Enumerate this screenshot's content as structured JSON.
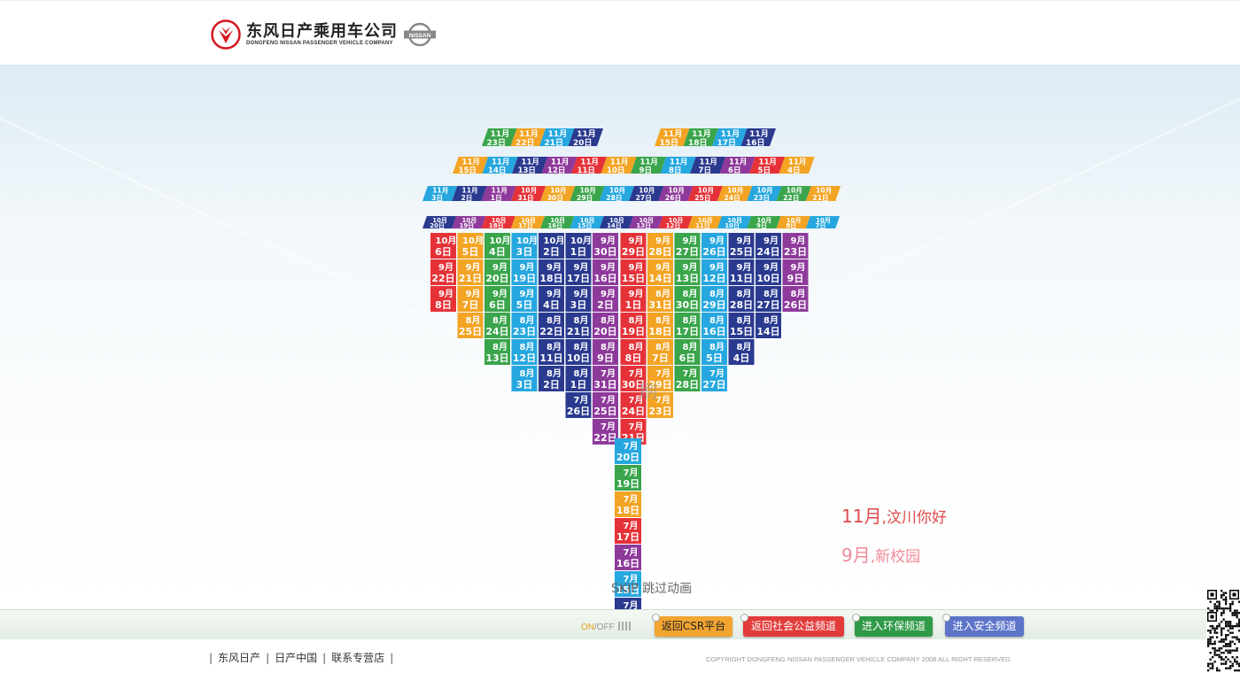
{
  "brand": {
    "name_cn": "东风日产乘用车公司",
    "name_en": "DONGFENG NISSAN PASSENGER VEHICLE COMPANY",
    "partner_logo": "NISSAN"
  },
  "colors": {
    "red": "#e53238",
    "orange": "#f3a424",
    "green": "#3aa54b",
    "blue": "#26a7df",
    "purple": "#8e3a9b",
    "navy": "#2a3a8f",
    "teal": "#1ea59b"
  },
  "grid_columns": [
    {
      "color": "red",
      "cells": [
        [
          "10月",
          "6日"
        ],
        [
          "9月",
          "22日"
        ],
        [
          "9月",
          "8日"
        ]
      ]
    },
    {
      "color": "orange",
      "cells": [
        [
          "10月",
          "5日"
        ],
        [
          "9月",
          "21日"
        ],
        [
          "9月",
          "7日"
        ],
        [
          "8月",
          "25日"
        ]
      ]
    },
    {
      "color": "green",
      "cells": [
        [
          "10月",
          "4日"
        ],
        [
          "9月",
          "20日"
        ],
        [
          "9月",
          "6日"
        ],
        [
          "8月",
          "24日"
        ],
        [
          "8月",
          "13日"
        ]
      ]
    },
    {
      "color": "blue",
      "cells": [
        [
          "10月",
          "3日"
        ],
        [
          "9月",
          "19日"
        ],
        [
          "9月",
          "5日"
        ],
        [
          "8月",
          "23日"
        ],
        [
          "8月",
          "12日"
        ],
        [
          "8月",
          "3日"
        ]
      ]
    },
    {
      "color": "navy",
      "cells": [
        [
          "10月",
          "2日"
        ],
        [
          "9月",
          "18日"
        ],
        [
          "9月",
          "4日"
        ],
        [
          "8月",
          "22日"
        ],
        [
          "8月",
          "11日"
        ],
        [
          "8月",
          "2日"
        ]
      ]
    },
    {
      "color": "navy",
      "cells": [
        [
          "10月",
          "1日"
        ],
        [
          "9月",
          "17日"
        ],
        [
          "9月",
          "3日"
        ],
        [
          "8月",
          "21日"
        ],
        [
          "8月",
          "10日"
        ],
        [
          "8月",
          "1日"
        ],
        [
          "7月",
          "26日"
        ]
      ]
    },
    {
      "color": "purple",
      "cells": [
        [
          "9月",
          "30日"
        ],
        [
          "9月",
          "16日"
        ],
        [
          "9月",
          "2日"
        ],
        [
          "8月",
          "20日"
        ],
        [
          "8月",
          "9日"
        ],
        [
          "7月",
          "31日"
        ],
        [
          "7月",
          "25日"
        ],
        [
          "7月",
          "22日"
        ]
      ]
    },
    {
      "color": "red",
      "cells": [
        [
          "9月",
          "29日"
        ],
        [
          "9月",
          "15日"
        ],
        [
          "9月",
          "1日"
        ],
        [
          "8月",
          "19日"
        ],
        [
          "8月",
          "8日"
        ],
        [
          "7月",
          "30日"
        ],
        [
          "7月",
          "24日"
        ],
        [
          "7月",
          "21日"
        ]
      ]
    },
    {
      "color": "orange",
      "cells": [
        [
          "9月",
          "28日"
        ],
        [
          "9月",
          "14日"
        ],
        [
          "8月",
          "31日"
        ],
        [
          "8月",
          "18日"
        ],
        [
          "8月",
          "7日"
        ],
        [
          "7月",
          "29日"
        ],
        [
          "7月",
          "23日"
        ]
      ]
    },
    {
      "color": "green",
      "cells": [
        [
          "9月",
          "27日"
        ],
        [
          "9月",
          "13日"
        ],
        [
          "8月",
          "30日"
        ],
        [
          "8月",
          "17日"
        ],
        [
          "8月",
          "6日"
        ],
        [
          "7月",
          "28日"
        ]
      ]
    },
    {
      "color": "blue",
      "cells": [
        [
          "9月",
          "26日"
        ],
        [
          "9月",
          "12日"
        ],
        [
          "8月",
          "29日"
        ],
        [
          "8月",
          "16日"
        ],
        [
          "8月",
          "5日"
        ],
        [
          "7月",
          "27日"
        ]
      ]
    },
    {
      "color": "navy",
      "cells": [
        [
          "9月",
          "25日"
        ],
        [
          "9月",
          "11日"
        ],
        [
          "8月",
          "28日"
        ],
        [
          "8月",
          "15日"
        ],
        [
          "8月",
          "4日"
        ]
      ]
    },
    {
      "color": "navy",
      "cells": [
        [
          "9月",
          "24日"
        ],
        [
          "9月",
          "10日"
        ],
        [
          "8月",
          "27日"
        ],
        [
          "8月",
          "14日"
        ]
      ]
    },
    {
      "color": "purple",
      "cells": [
        [
          "9月",
          "23日"
        ],
        [
          "9月",
          "9日"
        ],
        [
          "8月",
          "26日"
        ]
      ]
    }
  ],
  "trunk_cells": [
    {
      "color": "blue",
      "lines": [
        "7月",
        "20日"
      ]
    },
    {
      "color": "green",
      "lines": [
        "7月",
        "19日"
      ]
    },
    {
      "color": "orange",
      "lines": [
        "7月",
        "18日"
      ]
    },
    {
      "color": "red",
      "lines": [
        "7月",
        "17日"
      ]
    },
    {
      "color": "purple",
      "lines": [
        "7月",
        "16日"
      ]
    },
    {
      "color": "blue",
      "lines": [
        "7月",
        "15日"
      ]
    },
    {
      "color": "navy",
      "lines": [
        "7月",
        ""
      ]
    }
  ],
  "perspective_rows": [
    {
      "top": [
        "11月",
        "11月",
        "11月",
        "11月",
        "",
        "",
        "11月",
        "11月",
        "11月",
        "11月"
      ],
      "bottom": [
        "23日",
        "22日",
        "21日",
        "20日",
        "",
        "",
        "15日",
        "18日",
        "17日",
        "16日"
      ]
    },
    {
      "top": [
        "11月",
        "11月",
        "11月",
        "11月",
        "11月",
        "11月",
        "11月",
        "11月",
        "11月",
        "11月",
        "11月",
        "11月"
      ],
      "bottom": [
        "15日",
        "14日",
        "13日",
        "12日",
        "11日",
        "10日",
        "9日",
        "8日",
        "7日",
        "6日",
        "5日",
        "4日"
      ]
    },
    {
      "top": [
        "11月",
        "11月",
        "11月",
        "10月",
        "10月",
        "10月",
        "10月",
        "10月",
        "10月",
        "10月",
        "10月",
        "10月",
        "10月",
        "10月"
      ],
      "bottom": [
        "3日",
        "2日",
        "1日",
        "31日",
        "30日",
        "29日",
        "28日",
        "27日",
        "26日",
        "25日",
        "24日",
        "23日",
        "22日",
        "21日"
      ]
    },
    {
      "top": [
        "10月",
        "10月",
        "10月",
        "10月",
        "10月",
        "10月",
        "10月",
        "10月",
        "10月",
        "10月",
        "10月",
        "10月",
        "10月",
        "10月"
      ],
      "bottom": [
        "20日",
        "19日",
        "18日",
        "17日",
        "16日",
        "15日",
        "14日",
        "13日",
        "12日",
        "11日",
        "10日",
        "9日",
        "8日",
        "7日"
      ]
    }
  ],
  "overlay_text": "刷",
  "taglines": [
    {
      "month": "11月",
      "text": ",汶川你好"
    },
    {
      "month": "9月",
      "text": ",新校园"
    }
  ],
  "skip_label": "SKIP 跳过动画",
  "sound": {
    "on": "ON",
    "slash": "/",
    "off": "OFF"
  },
  "nav_buttons": [
    {
      "label": "返回CSR平台"
    },
    {
      "label": "返回社会公益频道"
    },
    {
      "label": "进入环保频道"
    },
    {
      "label": "进入安全频道"
    }
  ],
  "footer_links": [
    "东风日产",
    "日产中国",
    "联系专营店"
  ],
  "copyright": "COPYRIGHT DONGFENG NISSAN PASSENGER VEHICLE COMPANY 2008 ALL RIGHT RESERVED"
}
